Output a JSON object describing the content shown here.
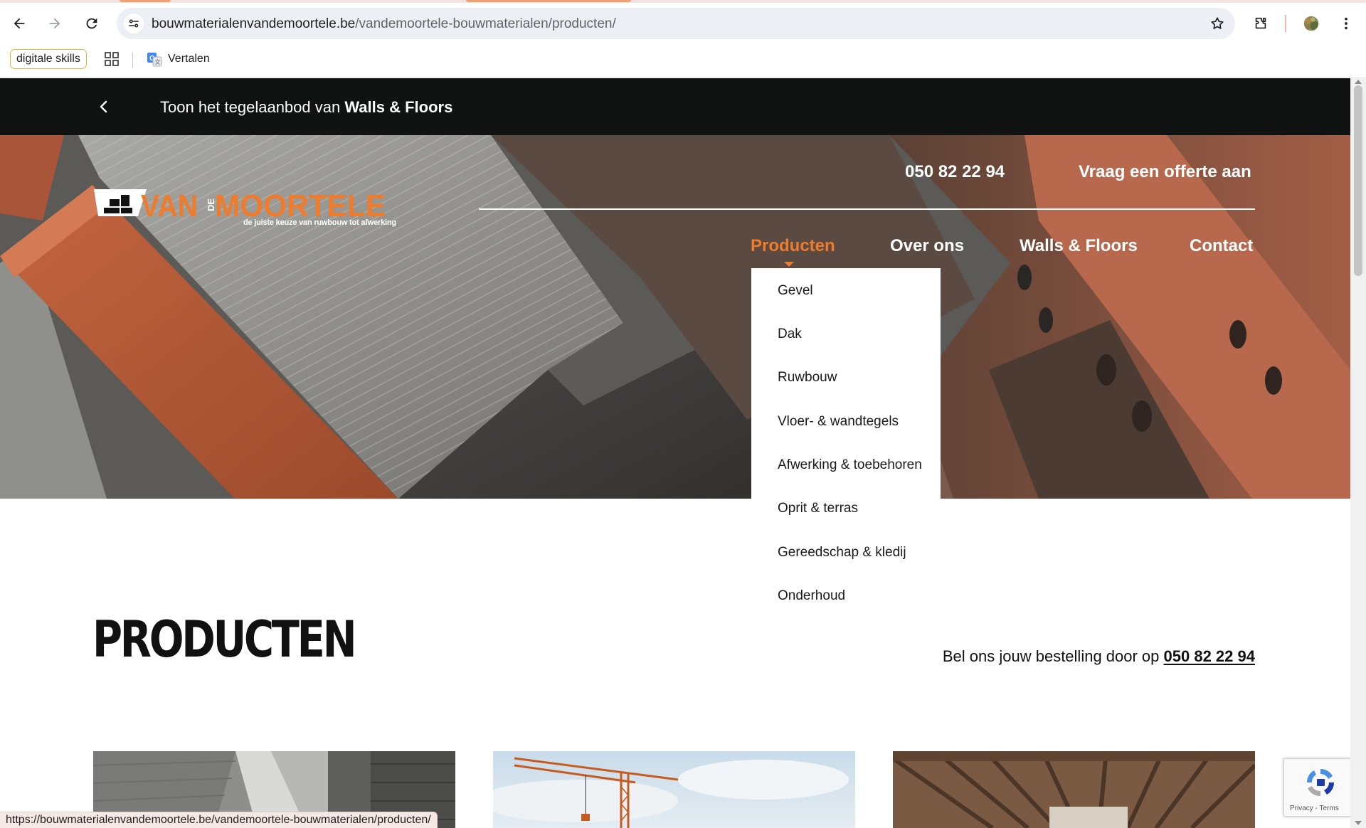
{
  "browser": {
    "url_domain": "bouwmaterialenvandemoortele.be",
    "url_path": "/vandemoortele-bouwmaterialen/producten/",
    "status_url": "https://bouwmaterialenvandemoortele.be/vandemoortele-bouwmaterialen/producten/",
    "bookmarks": [
      {
        "label": "digitale skills"
      },
      {
        "label": "Vertalen"
      }
    ],
    "icons": [
      "back-icon",
      "forward-icon",
      "reload-icon",
      "site-info-icon",
      "star-icon",
      "extensions-icon",
      "avatar",
      "menu-icon",
      "apps-grid-icon",
      "translate-icon"
    ]
  },
  "announcement": {
    "prefix": "Toon het tegelaanbod van",
    "brand": "Walls & Floors"
  },
  "header": {
    "logo_text": "VAN DE MOORTELE",
    "logo_parts": {
      "van": "VAN",
      "de": "DE",
      "moortele": "MOORTELE"
    },
    "tagline": "de juiste keuze van ruwbouw tot afwerking",
    "phone": "050 82 22 94",
    "quote": "Vraag een offerte aan"
  },
  "nav": {
    "items": [
      {
        "label": "Producten",
        "active": true
      },
      {
        "label": "Over ons"
      },
      {
        "label": "Walls & Floors"
      },
      {
        "label": "Contact"
      }
    ]
  },
  "dropdown": {
    "items": [
      "Gevel",
      "Dak",
      "Ruwbouw",
      "Vloer- & wandtegels",
      "Afwerking & toebehoren",
      "Oprit & terras",
      "Gereedschap & kledij",
      "Onderhoud"
    ]
  },
  "main": {
    "title": "PRODUCTEN",
    "order_prefix": "Bel ons jouw bestelling door op",
    "order_phone": "050 82 22 94"
  },
  "recaptcha": {
    "links": "Privacy - Terms"
  },
  "colors": {
    "accent": "#ee7c2c",
    "announcement_bg": "#111212",
    "text": "#111111"
  }
}
